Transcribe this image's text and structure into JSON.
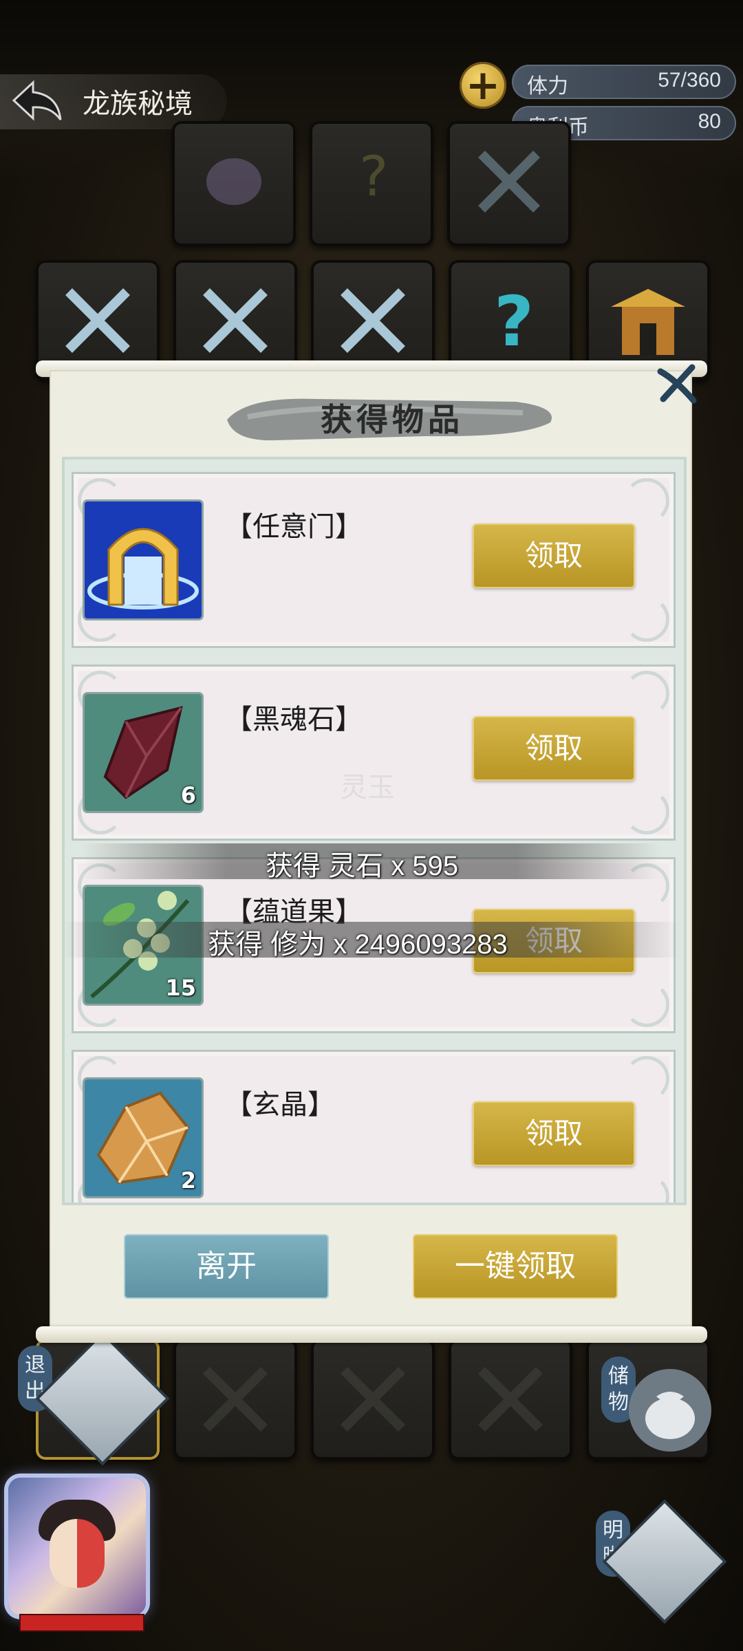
{
  "header": {
    "location": "龙族秘境",
    "resources": [
      {
        "label": "体力",
        "value": "57/360"
      },
      {
        "label": "奥利币",
        "value": "80"
      }
    ]
  },
  "side": {
    "exit_label": "退出",
    "storage_label": "储物",
    "insight_label": "明晰"
  },
  "dialog": {
    "title": "获得物品",
    "items": [
      {
        "name": "【任意门】",
        "count": "",
        "claim_label": "领取",
        "icon": "portal-gate-icon"
      },
      {
        "name": "【黑魂石】",
        "count": "6",
        "claim_label": "领取",
        "icon": "dark-soul-stone-icon"
      },
      {
        "name": "【蕴道果】",
        "count": "15",
        "claim_label": "领取",
        "icon": "dao-fruit-icon"
      },
      {
        "name": "【玄晶】",
        "count": "2",
        "claim_label": "领取",
        "icon": "mystic-crystal-icon"
      }
    ],
    "leave_label": "离开",
    "claim_all_label": "一键领取"
  },
  "notifications": {
    "faded": "灵玉",
    "spirit_stone": "获得 灵石 x 595",
    "cultivation": "获得 修为 x 2496093283"
  },
  "colors": {
    "gold_button": "#c7a536",
    "teal_button": "#6ea2b0",
    "hp_bar": "#c82522"
  }
}
